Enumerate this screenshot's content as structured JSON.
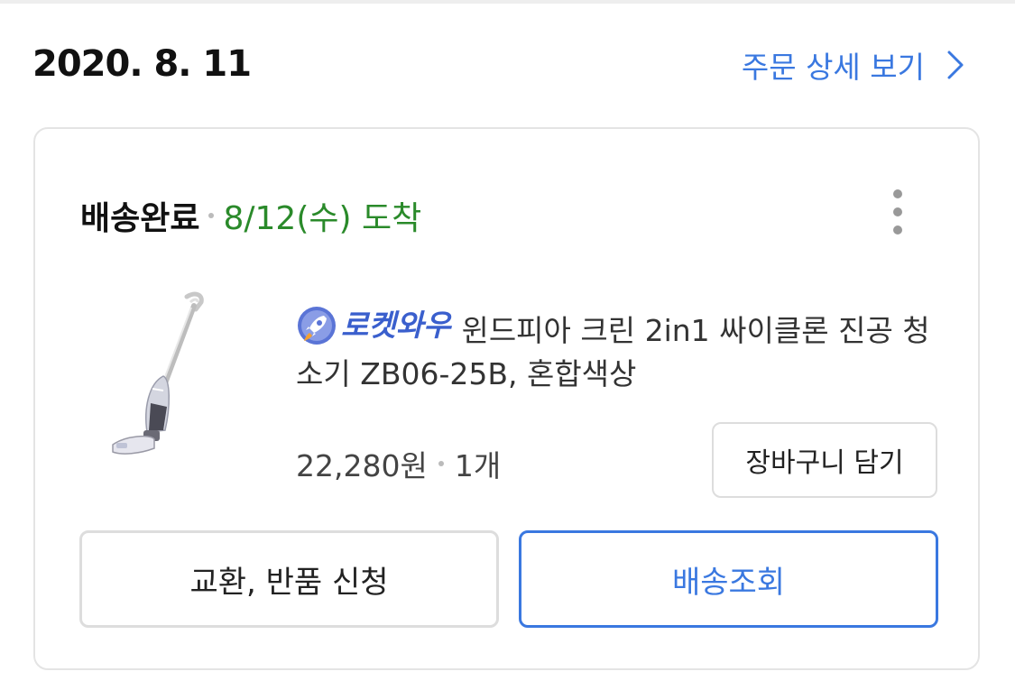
{
  "order": {
    "date": "2020. 8. 11",
    "detail_link": "주문 상세 보기"
  },
  "shipment": {
    "status": "배송완료",
    "arrival": "8/12(수) 도착"
  },
  "product": {
    "badge_text": "로켓와우",
    "name": "윈드피아 크린 2in1 싸이클론 진공 청소기 ZB06-25B, 혼합색상",
    "price": "22,280원",
    "quantity": "1개"
  },
  "buttons": {
    "add_to_cart": "장바구니 담기",
    "exchange_return": "교환, 반품 신청",
    "track_delivery": "배송조회"
  },
  "colors": {
    "accent_blue": "#3a78e0",
    "arrival_green": "#2a8a2a",
    "rocket_blue": "#3a5fcd"
  },
  "icons": {
    "detail_chevron": "chevron-right-icon",
    "more_menu": "vertical-more-icon",
    "rocket_badge": "rocket-icon"
  }
}
